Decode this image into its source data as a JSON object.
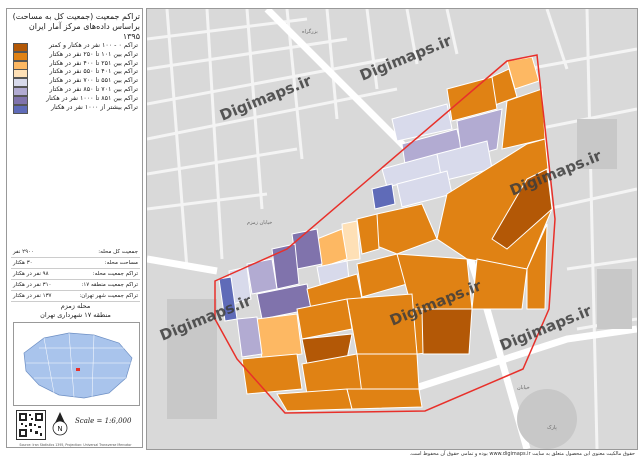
{
  "panel": {
    "title": "تراکم جمعیت (جمعیت کل به مساحت) براساس داده‌های مرکز آمار ایران ۱۳۹۵"
  },
  "legend": [
    {
      "label": "تراکم ۰ - ۱۰۰ نفر در هکتار و کمتر",
      "color": "#b35806"
    },
    {
      "label": "تراکم بین ۱۰۱ تا ۲۵۰ نفر در هکتار",
      "color": "#e08214"
    },
    {
      "label": "تراکم بین ۲۵۱ تا ۴۰۰ نفر در هکتار",
      "color": "#fdb863"
    },
    {
      "label": "تراکم بین ۴۰۱ تا ۵۵۰ نفر در هکتار",
      "color": "#fee0b6"
    },
    {
      "label": "تراکم بین ۵۵۱ تا ۷۰۰ نفر در هکتار",
      "color": "#d8daeb"
    },
    {
      "label": "تراکم بین ۷۰۱ تا ۸۵۰ نفر در هکتار",
      "color": "#b2abd2"
    },
    {
      "label": "تراکم بین ۸۵۱ تا ۱۰۰۰ نفر در هکتار",
      "color": "#8073ac"
    },
    {
      "label": "تراکم بیشتر از ۱۰۰۰ نفر در هکتار",
      "color": "#5f6bb8"
    }
  ],
  "stats": [
    {
      "key": "جمعیت کل محله:",
      "value": "۲۹۰۰ نفر"
    },
    {
      "key": "مساحت محله:",
      "value": "۳۰ هکتار"
    },
    {
      "key": "تراکم جمعیت محله:",
      "value": "۹۸ نفر در هکتار"
    },
    {
      "key": "تراکم جمعیت منطقه ۱۷:",
      "value": "۳۱۰ نفر در هکتار"
    },
    {
      "key": "تراکم جمعیت شهر تهران:",
      "value": "۱۳۷ نفر در هکتار"
    }
  ],
  "region": {
    "line1": "محله زمزم",
    "line2": "منطقه ۱۷ شهرداری تهران"
  },
  "scale": "Scale = 1:6,000",
  "north": "N",
  "credit": "Source: Iran Statistics 1395, Projection: Universal Transverse Mercator",
  "footer": "حقوق مالکیت معنوی این محصول متعلق به سایت www.digimaps.ir بوده و تمامی حقوق آن محفوظ است.",
  "watermarks": [
    "Digimaps.ir",
    "Digimaps.ir",
    "Digimaps.ir",
    "Digimaps.ir",
    "Digimaps.ir",
    "Digimaps.ir"
  ],
  "map_labels": [
    "بزرگراه",
    "خیابان",
    "پارک",
    "خیابان زمزم"
  ],
  "colors": {
    "c1": "#b35806",
    "c2": "#e08214",
    "c3": "#fdb863",
    "c4": "#fee0b6",
    "c5": "#d8daeb",
    "c6": "#b2abd2",
    "c7": "#8073ac",
    "c8": "#5f6bb8",
    "boundary": "#e8302a",
    "basemap": "#d9d9d9"
  }
}
